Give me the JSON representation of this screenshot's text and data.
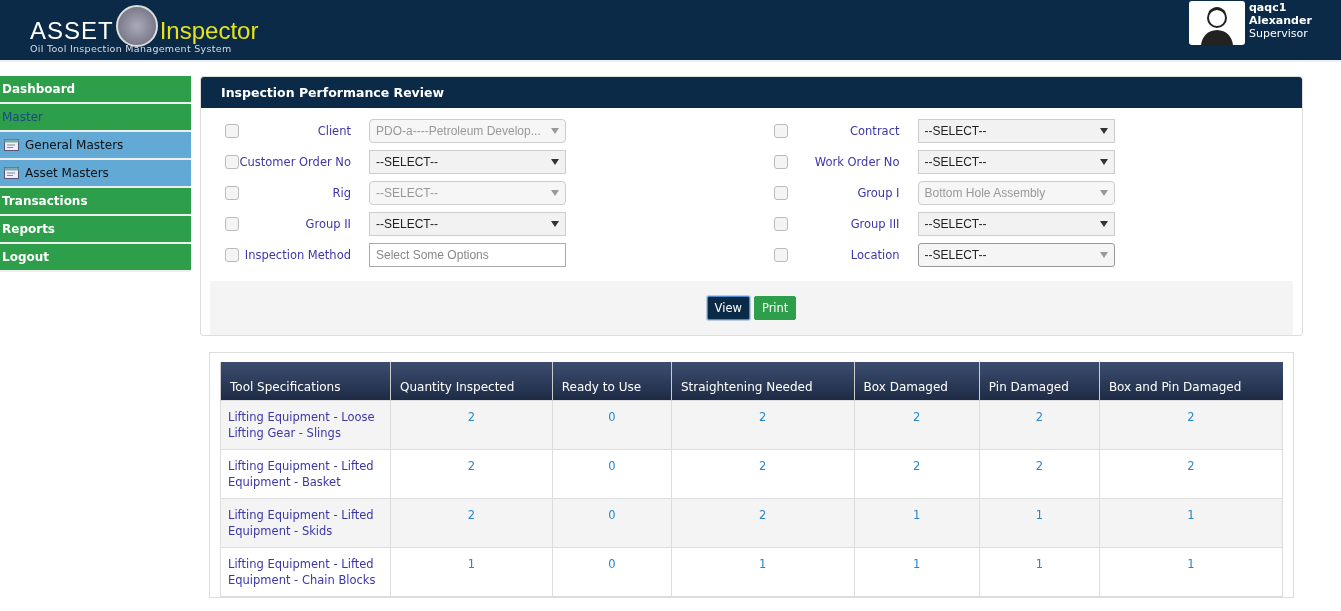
{
  "header": {
    "logo": {
      "word_1": "ASSET",
      "word_2": "Inspector",
      "tagline": "Oil Tool Inspection Management System"
    },
    "user": {
      "username": "qaqc1",
      "name": "Alexander",
      "role": "Supervisor"
    }
  },
  "sidebar": {
    "items": [
      {
        "label": "Dashboard",
        "kind": "main",
        "selected": false
      },
      {
        "label": "Master",
        "kind": "main",
        "selected": true
      },
      {
        "label": "General Masters",
        "kind": "sub",
        "selected": false
      },
      {
        "label": "Asset Masters",
        "kind": "sub",
        "selected": false
      },
      {
        "label": "Transactions",
        "kind": "main",
        "selected": false
      },
      {
        "label": "Reports",
        "kind": "main",
        "selected": false
      },
      {
        "label": "Logout",
        "kind": "main",
        "selected": false
      }
    ]
  },
  "panel": {
    "title": "Inspection Performance Review",
    "filters_left": [
      {
        "label": "Client",
        "checked": false,
        "kind": "select",
        "value": "PDO-a----Petroleum Develop...",
        "disabled": true
      },
      {
        "label": "Customer Order No",
        "checked": false,
        "kind": "select",
        "value": "--SELECT--",
        "disabled": false
      },
      {
        "label": "Rig",
        "checked": false,
        "kind": "select",
        "value": "--SELECT--",
        "disabled": true
      },
      {
        "label": "Group II",
        "checked": false,
        "kind": "select",
        "value": "--SELECT--",
        "disabled": false
      },
      {
        "label": "Inspection Method",
        "checked": false,
        "kind": "multiselect",
        "placeholder": "Select Some Options"
      }
    ],
    "filters_right": [
      {
        "label": "Contract",
        "checked": false,
        "kind": "select",
        "value": "--SELECT--",
        "disabled": false
      },
      {
        "label": "Work Order No",
        "checked": false,
        "kind": "select",
        "value": "--SELECT--",
        "disabled": false
      },
      {
        "label": "Group I",
        "checked": false,
        "kind": "select",
        "value": "Bottom Hole Assembly",
        "disabled": true
      },
      {
        "label": "Group III",
        "checked": false,
        "kind": "select",
        "value": "--SELECT--",
        "disabled": false
      },
      {
        "label": "Location",
        "checked": false,
        "kind": "rounded",
        "value": "--SELECT--",
        "disabled": false
      }
    ],
    "buttons": [
      {
        "label": "View",
        "kind": "primary"
      },
      {
        "label": "Print",
        "kind": "success"
      }
    ]
  },
  "table": {
    "columns": [
      "Tool Specifications",
      "Quantity Inspected",
      "Ready to Use",
      "Straightening Needed",
      "Box Damaged",
      "Pin Damaged",
      "Box and Pin Damaged"
    ],
    "rows": [
      [
        "Lifting Equipment - Loose Lifting Gear - Slings",
        "2",
        "0",
        "2",
        "2",
        "2",
        "2"
      ],
      [
        "Lifting Equipment - Lifted Equipment - Basket",
        "2",
        "0",
        "2",
        "2",
        "2",
        "2"
      ],
      [
        "Lifting Equipment - Lifted Equipment - Skids",
        "2",
        "0",
        "2",
        "1",
        "1",
        "1"
      ],
      [
        "Lifting Equipment - Lifted Equipment - Chain Blocks",
        "1",
        "0",
        "1",
        "1",
        "1",
        "1"
      ]
    ]
  }
}
